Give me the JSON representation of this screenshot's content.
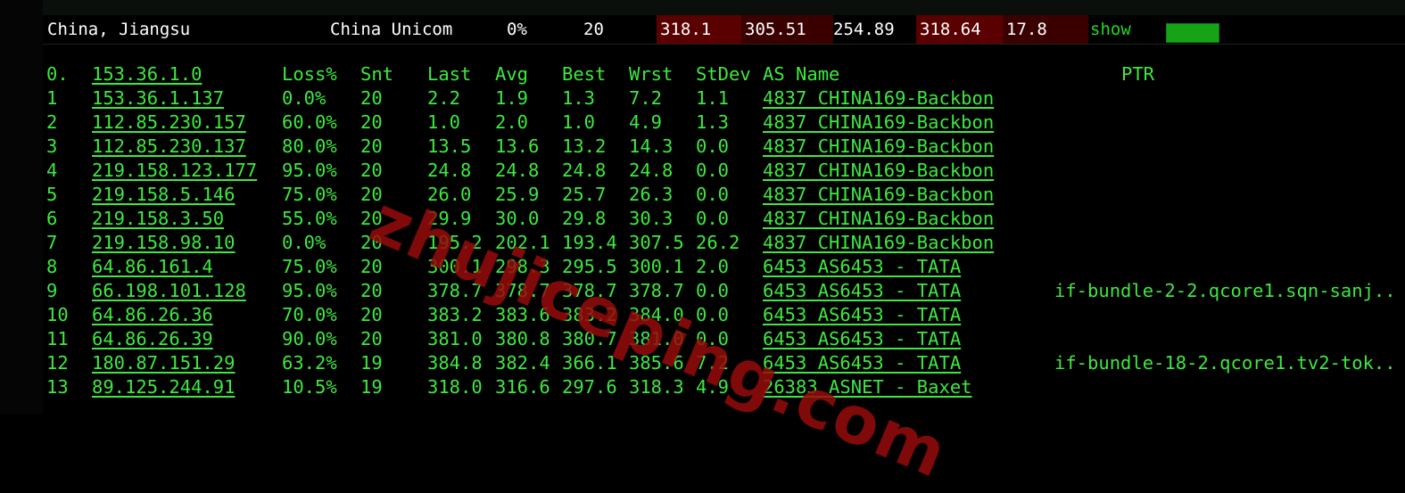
{
  "summary": {
    "location": "China, Jiangsu",
    "isp": "China Unicom",
    "loss": "0%",
    "sent": "20",
    "last": "318.1",
    "avg": "305.51",
    "best": "254.89",
    "worst": "318.64",
    "stdev": "17.8",
    "show_label": "show"
  },
  "header": {
    "hop": "0.",
    "host": "153.36.1.0",
    "loss": "Loss%",
    "snt": "Snt",
    "last": "Last",
    "avg": "Avg",
    "best": "Best",
    "wrst": "Wrst",
    "stdev": "StDev",
    "asname": "AS Name",
    "ptr": "PTR"
  },
  "hops": [
    {
      "n": "1",
      "host": "153.36.1.137",
      "loss": "0.0%",
      "snt": "20",
      "last": "2.2",
      "avg": "1.9",
      "best": "1.3",
      "wrst": "7.2",
      "stdev": "1.1",
      "as": "4837  CHINA169-Backbon",
      "ptr": ""
    },
    {
      "n": "2",
      "host": "112.85.230.157",
      "loss": "60.0%",
      "snt": "20",
      "last": "1.0",
      "avg": "2.0",
      "best": "1.0",
      "wrst": "4.9",
      "stdev": "1.3",
      "as": "4837  CHINA169-Backbon",
      "ptr": ""
    },
    {
      "n": "3",
      "host": "112.85.230.137",
      "loss": "80.0%",
      "snt": "20",
      "last": "13.5",
      "avg": "13.6",
      "best": "13.2",
      "wrst": "14.3",
      "stdev": "0.0",
      "as": "4837  CHINA169-Backbon",
      "ptr": ""
    },
    {
      "n": "4",
      "host": "219.158.123.177",
      "loss": "95.0%",
      "snt": "20",
      "last": "24.8",
      "avg": "24.8",
      "best": "24.8",
      "wrst": "24.8",
      "stdev": "0.0",
      "as": "4837  CHINA169-Backbon",
      "ptr": ""
    },
    {
      "n": "5",
      "host": "219.158.5.146",
      "loss": "75.0%",
      "snt": "20",
      "last": "26.0",
      "avg": "25.9",
      "best": "25.7",
      "wrst": "26.3",
      "stdev": "0.0",
      "as": "4837  CHINA169-Backbon",
      "ptr": ""
    },
    {
      "n": "6",
      "host": "219.158.3.50",
      "loss": "55.0%",
      "snt": "20",
      "last": "29.9",
      "avg": "30.0",
      "best": "29.8",
      "wrst": "30.3",
      "stdev": "0.0",
      "as": "4837  CHINA169-Backbon",
      "ptr": ""
    },
    {
      "n": "7",
      "host": "219.158.98.10",
      "loss": "0.0%",
      "snt": "20",
      "last": "195.2",
      "avg": "202.1",
      "best": "193.4",
      "wrst": "307.5",
      "stdev": "26.2",
      "as": "4837  CHINA169-Backbon",
      "ptr": ""
    },
    {
      "n": "8",
      "host": "64.86.161.4",
      "loss": "75.0%",
      "snt": "20",
      "last": "300.1",
      "avg": "298.3",
      "best": "295.5",
      "wrst": "300.1",
      "stdev": "2.0",
      "as": "6453  AS6453 - TATA",
      "ptr": ""
    },
    {
      "n": "9",
      "host": "66.198.101.128",
      "loss": "95.0%",
      "snt": "20",
      "last": "378.7",
      "avg": "378.7",
      "best": "378.7",
      "wrst": "378.7",
      "stdev": "0.0",
      "as": "6453  AS6453 - TATA",
      "ptr": "if-bundle-2-2.qcore1.sqn-sanj.."
    },
    {
      "n": "10",
      "host": "64.86.26.36",
      "loss": "70.0%",
      "snt": "20",
      "last": "383.2",
      "avg": "383.6",
      "best": "383.2",
      "wrst": "384.0",
      "stdev": "0.0",
      "as": "6453  AS6453 - TATA",
      "ptr": ""
    },
    {
      "n": "11",
      "host": "64.86.26.39",
      "loss": "90.0%",
      "snt": "20",
      "last": "381.0",
      "avg": "380.8",
      "best": "380.7",
      "wrst": "381.0",
      "stdev": "0.0",
      "as": "6453  AS6453 - TATA",
      "ptr": ""
    },
    {
      "n": "12",
      "host": "180.87.151.29",
      "loss": "63.2%",
      "snt": "19",
      "last": "384.8",
      "avg": "382.4",
      "best": "366.1",
      "wrst": "385.6",
      "stdev": "7.2",
      "as": "6453  AS6453 - TATA",
      "ptr": "if-bundle-18-2.qcore1.tv2-tok.."
    },
    {
      "n": "13",
      "host": "89.125.244.91",
      "loss": "10.5%",
      "snt": "19",
      "last": "318.0",
      "avg": "316.6",
      "best": "297.6",
      "wrst": "318.3",
      "stdev": "4.9",
      "as": "26383 ASNET - Baxet",
      "ptr": ""
    }
  ],
  "watermark": "zhujiceping.com",
  "colors": {
    "text_green": "#3ee83e",
    "cell_red": "#5a0000",
    "bar_green": "#16a316"
  }
}
